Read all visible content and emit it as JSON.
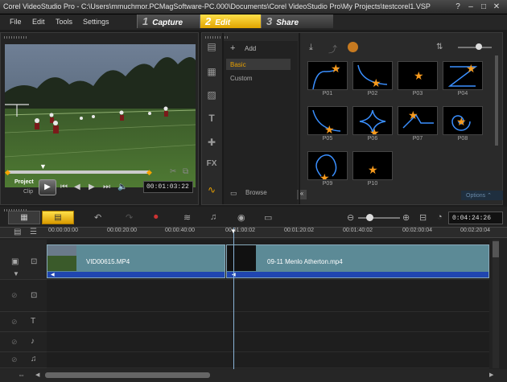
{
  "window": {
    "title": "Corel VideoStudio Pro - C:\\Users\\mmuchmor.PCMagSoftware-PC.000\\Documents\\Corel VideoStudio Pro\\My Projects\\testcorel1.VSP"
  },
  "menu": [
    "File",
    "Edit",
    "Tools",
    "Settings"
  ],
  "steps": [
    {
      "num": "1",
      "label": "Capture"
    },
    {
      "num": "2",
      "label": "Edit"
    },
    {
      "num": "3",
      "label": "Share"
    }
  ],
  "preview": {
    "project_label": "Project",
    "clip_label": "Clip",
    "timecode": "00:01:03:22"
  },
  "library": {
    "add_label": "Add",
    "folders": [
      "Basic",
      "Custom"
    ],
    "browse_label": "Browse",
    "options_label": "Options",
    "items": [
      "P01",
      "P02",
      "P03",
      "P04",
      "P05",
      "P06",
      "P07",
      "P08",
      "P09",
      "P10"
    ]
  },
  "timeline": {
    "timecode": "0:04:24:26",
    "ruler": [
      "00:00:00:00",
      "00:00:20:00",
      "00:00:40:00",
      "00:01:00:02",
      "00:01:20:02",
      "00:01:40:02",
      "00:02:00:04",
      "00:02:20:04"
    ],
    "clips": [
      {
        "name": "VID00615.MP4"
      },
      {
        "name": "09-11 Menlo Atherton.mp4"
      }
    ]
  }
}
